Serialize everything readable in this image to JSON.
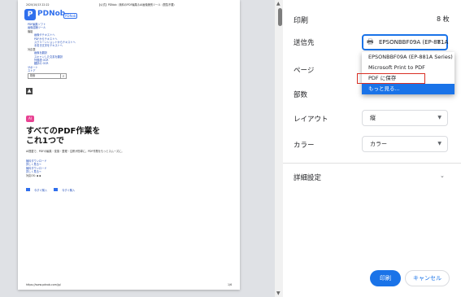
{
  "preview": {
    "header_left": "2020/10/13 22:22",
    "header_center": "【公式】PDNob｜無料のPDF編集＆AI画像識別ツール（閲覧不要）",
    "logo_text": "PDNob",
    "logo_small": "PDNob",
    "nav_items": [
      "PDF編集ソフト",
      "画像認識ツール",
      "機能",
      "画像やテキストへ",
      "PDFからテキストへ",
      "スクリーンショットからテキストへ",
      "手書き文字をテキストへ",
      "対応表",
      "画像を翻訳",
      "スキャンした文書を翻訳",
      "外国語 OCR",
      "翻訳の OCR",
      "サポート",
      "ストア"
    ],
    "search_placeholder": "検索",
    "badge_text": "AI",
    "heading_line1": "すべてのPDF作業を",
    "heading_line2": "これ1つで",
    "body_text": "AI搭載で、PDFの編集・変換・整理・注釈が簡単に。PDF作業をもっとスムーズに。",
    "link_lines": [
      "無料ダウンロード",
      "詳しく見る→",
      "無料ダウンロード",
      "詳しく見る→",
      "対応OS: ▪ ▪"
    ],
    "bottom_links": [
      "今すぐ購入",
      "今すぐ購入"
    ],
    "footer_left": "https://www.pdnob.com/jp/",
    "footer_right": "1/6"
  },
  "panel": {
    "title": "印刷",
    "sheet_count": "8 枚",
    "destination_label": "送信先",
    "destination_value": "EPSONBBF09A (EP-881A",
    "pages_label": "ページ",
    "copies_label": "部数",
    "layout_label": "レイアウト",
    "layout_value": "縦",
    "color_label": "カラー",
    "color_value": "カラー",
    "details_label": "詳細設定",
    "print_button": "印刷",
    "cancel_button": "キャンセル"
  },
  "dropdown": {
    "options": [
      "EPSONBBF09A (EP-881A Series)",
      "Microsoft Print to PDF",
      "PDF に保存",
      "もっと見る..."
    ],
    "highlight_color": "#1a73e8",
    "outline_color": "#d93025"
  },
  "colors": {
    "accent": "#1a73e8",
    "badge": "#e84393",
    "logo": "#2f6fed"
  },
  "icons": {
    "printer": "printer-icon",
    "search": "search-icon",
    "arrow_up": "arrow-up-icon"
  }
}
